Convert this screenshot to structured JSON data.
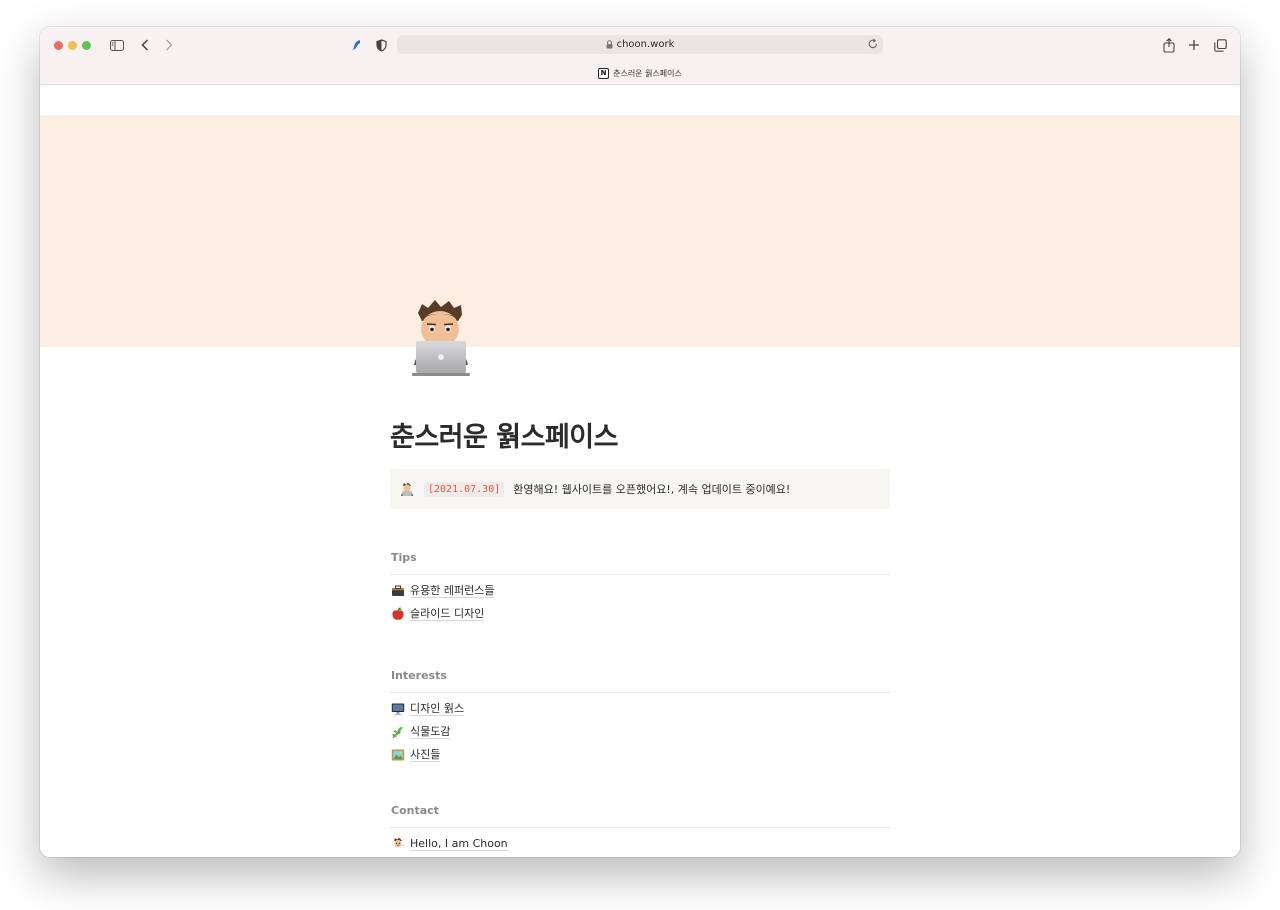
{
  "browser": {
    "url": "choon.work",
    "tab_title": "춘스러운 웕스페이스",
    "accent": "#f7f1f1"
  },
  "page": {
    "title": "춘스러운 웕스페이스",
    "cover_color": "#fbeee3",
    "callout": {
      "date_code": "[2021.07.30]",
      "text": "환영해요! 웹사이트를 오픈했어요!, 계속 업데이트 중이예요!"
    },
    "sections": [
      {
        "heading": "Tips",
        "items": [
          {
            "icon": "toolbox-icon",
            "label": "유용한 레퍼런스들"
          },
          {
            "icon": "apple-icon",
            "label": "슬라이드 디자인"
          }
        ]
      },
      {
        "heading": "Interests",
        "items": [
          {
            "icon": "monitor-icon",
            "label": "디자인 웕스"
          },
          {
            "icon": "herb-icon",
            "label": "식물도감"
          },
          {
            "icon": "framed-picture-icon",
            "label": "사진들"
          }
        ]
      },
      {
        "heading": "Contact",
        "items": [
          {
            "icon": "memoji-icon",
            "label": "Hello, I am Choon"
          }
        ]
      }
    ]
  }
}
